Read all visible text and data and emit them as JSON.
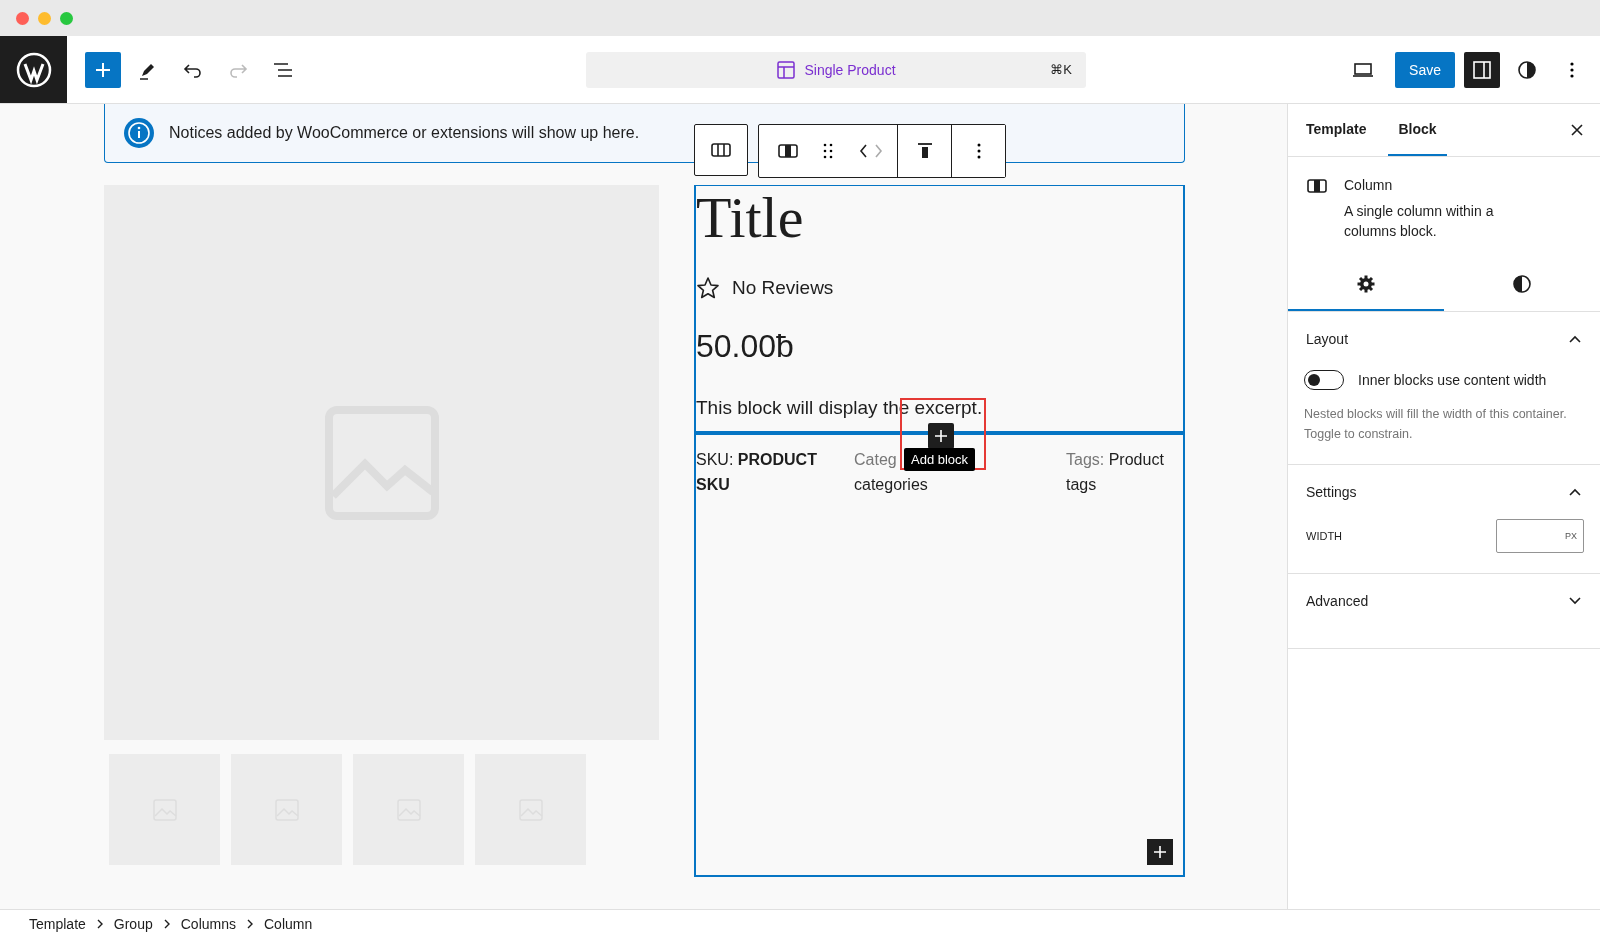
{
  "toolbar": {
    "document_title": "Single Product",
    "shortcut": "⌘K",
    "save_label": "Save"
  },
  "notice": {
    "text": "Notices added by WooCommerce or extensions will show up here."
  },
  "product": {
    "title": "Title",
    "reviews": "No Reviews",
    "price": "50.00ƀ",
    "excerpt": "This block will display the excerpt.",
    "meta": [
      {
        "kind": "sku",
        "label": "SKU:",
        "value": "PRODUCT SKU"
      },
      {
        "kind": "partial",
        "lines": [
          "Categ",
          "categories"
        ]
      },
      {
        "kind": "tags",
        "label": "Tags:",
        "value": "Product tags"
      }
    ]
  },
  "tooltip": "Add block",
  "sidebar": {
    "tabs": [
      {
        "label": "Template",
        "selected": false
      },
      {
        "label": "Block",
        "selected": true
      }
    ],
    "block": {
      "name": "Column",
      "description": "A single column within a columns block."
    },
    "subtabs": [
      {
        "kind": "settings",
        "selected": true
      },
      {
        "kind": "styles",
        "selected": false
      }
    ],
    "panels": [
      {
        "title": "Layout",
        "expanded": true,
        "toggle": {
          "label": "Inner blocks use content width",
          "on": false
        },
        "help": "Nested blocks will fill the width of this container. Toggle to constrain."
      },
      {
        "title": "Settings",
        "expanded": true,
        "field": {
          "label": "WIDTH",
          "unit": "PX"
        }
      },
      {
        "title": "Advanced",
        "expanded": false
      }
    ]
  },
  "breadcrumb": [
    "Template",
    "Group",
    "Columns",
    "Column"
  ]
}
